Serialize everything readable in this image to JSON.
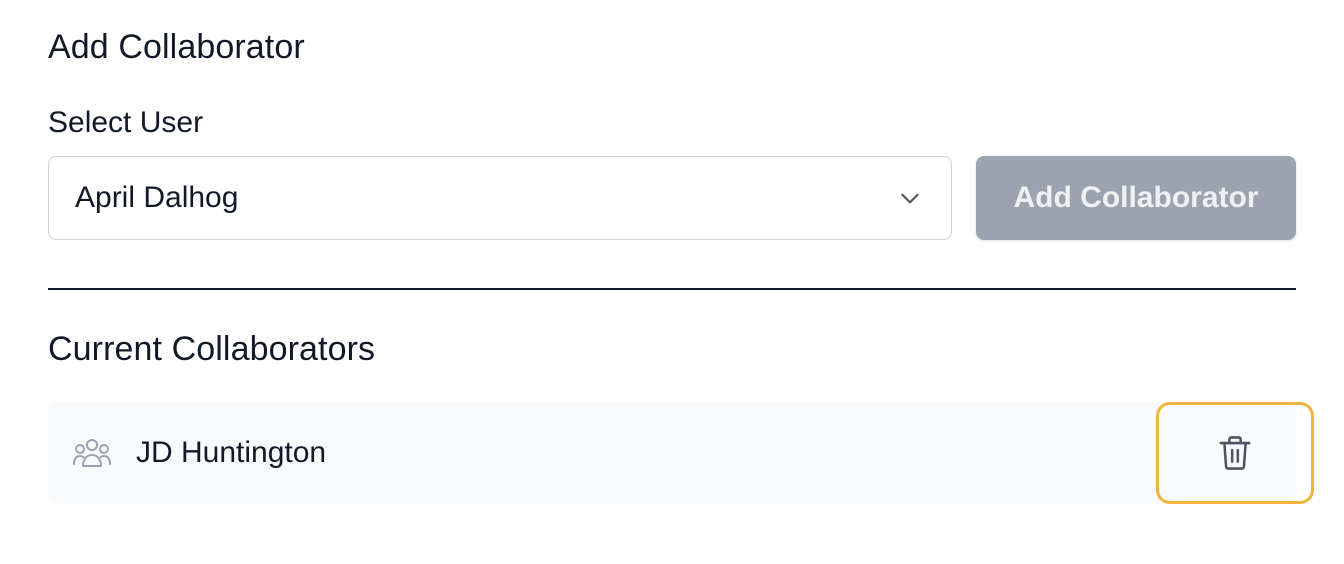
{
  "add_section": {
    "title": "Add Collaborator",
    "select_label": "Select User",
    "selected_user": "April Dalhog",
    "add_button_label": "Add Collaborator"
  },
  "current_section": {
    "title": "Current Collaborators",
    "collaborators": [
      {
        "name": "JD Huntington",
        "icon": "users-icon",
        "action_icon": "trash-icon"
      }
    ]
  },
  "colors": {
    "text": "#111827",
    "button_disabled": "#9ca3af",
    "row_background": "#f9fafb",
    "focus_ring": "#f0b33e"
  }
}
